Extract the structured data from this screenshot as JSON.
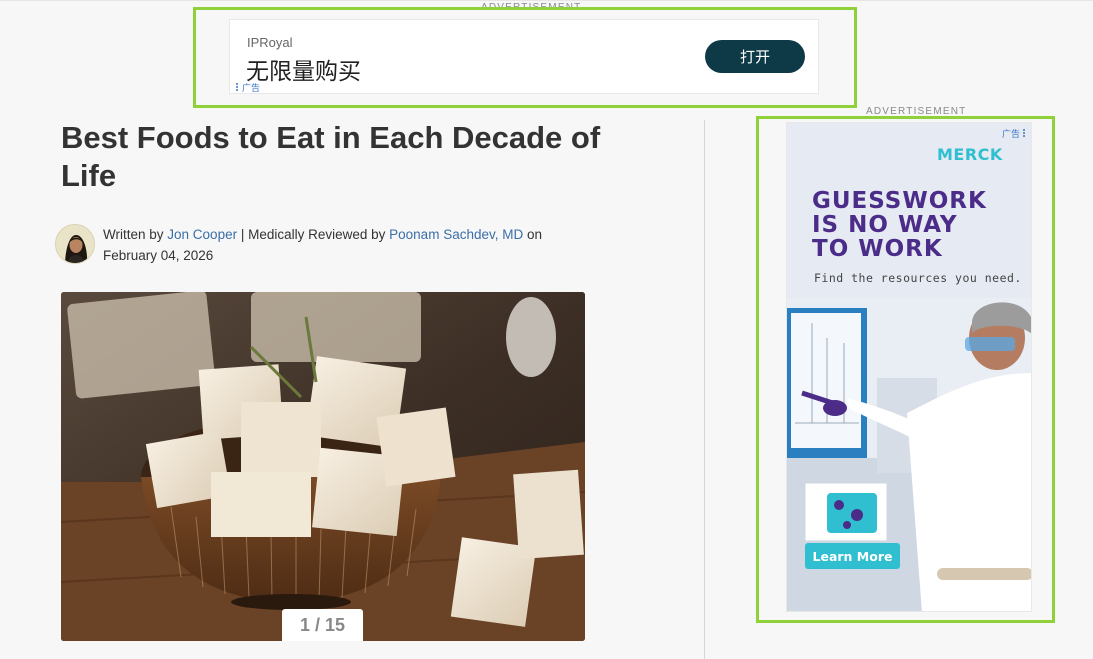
{
  "top_ad": {
    "label": "ADVERTISEMENT",
    "brand": "IPRoyal",
    "headline": "无限量购买",
    "button_label": "打开",
    "ad_tag": "广告"
  },
  "article": {
    "title": "Best Foods to Eat in Each Decade of Life",
    "byline": {
      "written_by_prefix": "Written by ",
      "author": "Jon Cooper",
      "reviewed_prefix": " | Medically Reviewed by ",
      "reviewer": "Poonam Sachdev, MD",
      "date_text": " on February 04, 2026"
    },
    "slideshow": {
      "pager_text": "1 / 15",
      "current": 1,
      "total": 15
    }
  },
  "side_ad": {
    "label": "ADVERTISEMENT",
    "ad_tag": "广告",
    "logo": "MERCK",
    "headline_lines": [
      "GUESSWORK",
      "IS NO WAY",
      "TO WORK"
    ],
    "subtext": "Find the resources you need.",
    "cta_label": "Learn More"
  },
  "colors": {
    "ad_frame": "#8ed13a",
    "link": "#3a6fa8",
    "ipr_button": "#0e3a47",
    "merck_purple": "#4b2c89",
    "merck_teal": "#2fbfd0"
  }
}
